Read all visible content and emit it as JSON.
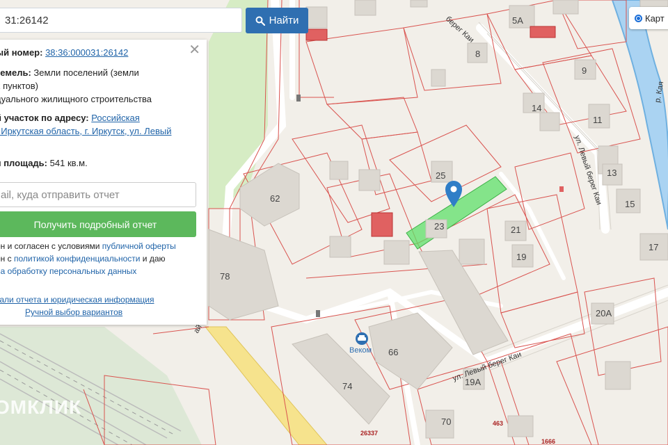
{
  "search": {
    "value": "31:26142",
    "button_label": "Найти"
  },
  "panel": {
    "cadastral_label": "ый номер:",
    "cadastral_value": "38:36:000031:26142",
    "land_label": "земель:",
    "land_value_1": "Земли поселений (земли",
    "land_value_2": "х пунктов)",
    "usage_value": "дуального жилищного строительства",
    "address_label": "й участок по адресу:",
    "address_link_1": "Российская",
    "address_link_2": ", Иркутская область, г. Иркутск, ул. Левый",
    "area_label": "я площадь:",
    "area_value": "541 кв.м.",
    "email_placeholder": "ail, куда отправить отчет",
    "report_button": "Получить подробный отчет",
    "consent_1a": "ен и согласен с условиями ",
    "consent_1b": "публичной оферты",
    "consent_2a": "ен с ",
    "consent_2b": "политикой конфиденциальности",
    "consent_2c": " и даю",
    "consent_3": "на обработку персональных данных",
    "details_link": "тали отчета и юридическая информация",
    "manual_link": "Ручной выбор вариантов"
  },
  "layer_switch": {
    "label": "Карт"
  },
  "watermark": "ОМКЛИК",
  "poi": {
    "name": "Веком"
  },
  "map": {
    "streets": {
      "levy_bereg_kai_upper": "ул. Левый берег Каи",
      "levy_bereg_kai_lower": "ул. Левый берег Каи",
      "levy_bereg_kai_top": "берег Каи",
      "kai_river": "р. Кая",
      "fragment": "ай"
    },
    "house_numbers": {
      "h5a": "5А",
      "h8": "8",
      "h9": "9",
      "h14": "14",
      "h11": "11",
      "h13": "13",
      "h15": "15",
      "h17": "17",
      "h25": "25",
      "h23": "23",
      "h21": "21",
      "h19": "19",
      "h62": "62",
      "h66": "66",
      "h74": "74",
      "h70": "70",
      "h20a": "20А",
      "h19a": "19А",
      "h78": "78"
    },
    "cadastral_numbers": {
      "c26337": "26337",
      "c463": "463",
      "c1666": "1666"
    }
  },
  "colors": {
    "selected_parcel": "#5fe06a",
    "parcel_border": "#d9534f",
    "marker": "#2f7ec7",
    "button_blue": "#2f6fb1",
    "button_green": "#5cb85c"
  }
}
